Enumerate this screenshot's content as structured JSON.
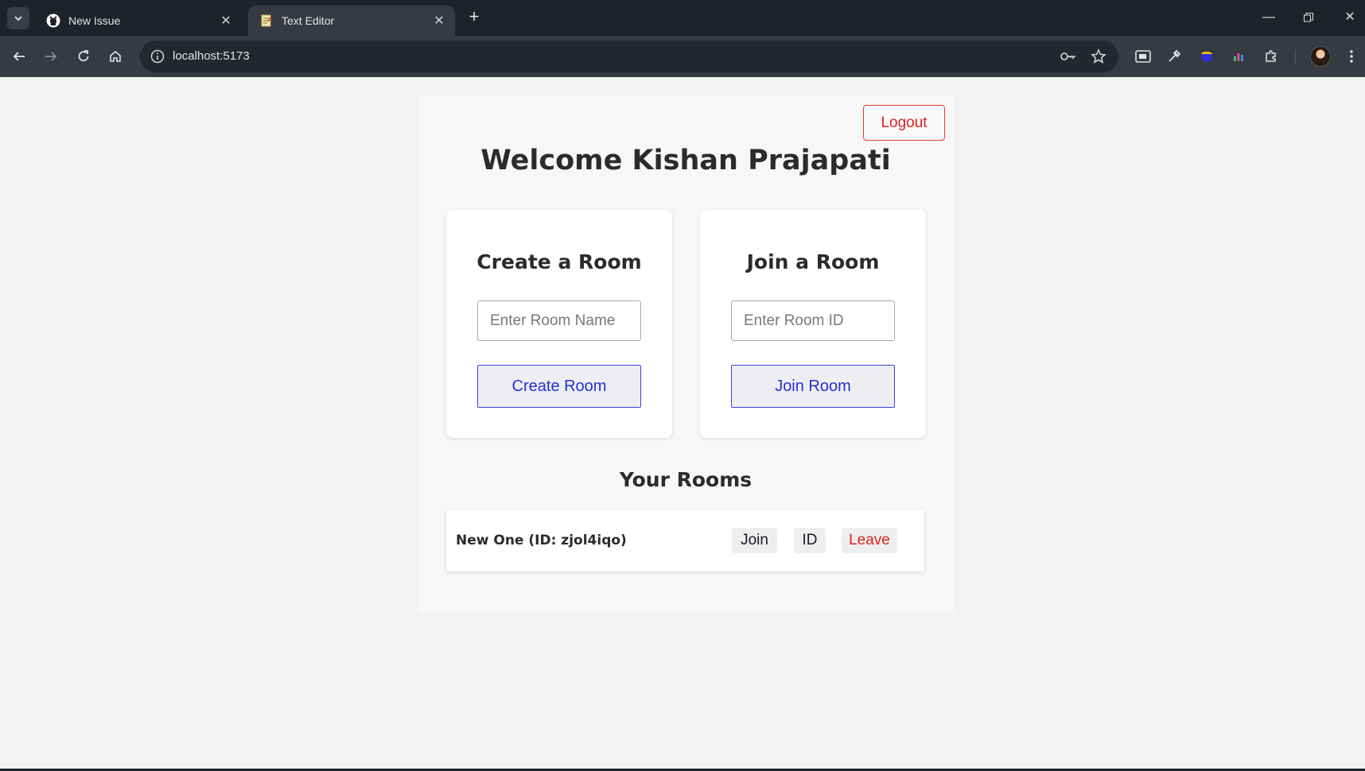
{
  "browser": {
    "tabs": [
      {
        "title": "New Issue",
        "icon": "github-icon"
      },
      {
        "title": "Text Editor",
        "icon": "notepad-icon"
      }
    ],
    "url": "localhost:5173"
  },
  "page": {
    "logout_label": "Logout",
    "welcome": "Welcome Kishan Prajapati",
    "create_card": {
      "title": "Create a Room",
      "placeholder": "Enter Room Name",
      "button": "Create Room"
    },
    "join_card": {
      "title": "Join a Room",
      "placeholder": "Enter Room ID",
      "button": "Join Room"
    },
    "rooms_title": "Your Rooms",
    "rooms": [
      {
        "label": "New One (ID: zjol4iqo)",
        "join": "Join",
        "id": "ID",
        "leave": "Leave"
      }
    ]
  },
  "colors": {
    "accent_blue": "#2430d0",
    "danger_red": "#e02020",
    "chrome_dark": "#1f2229"
  }
}
